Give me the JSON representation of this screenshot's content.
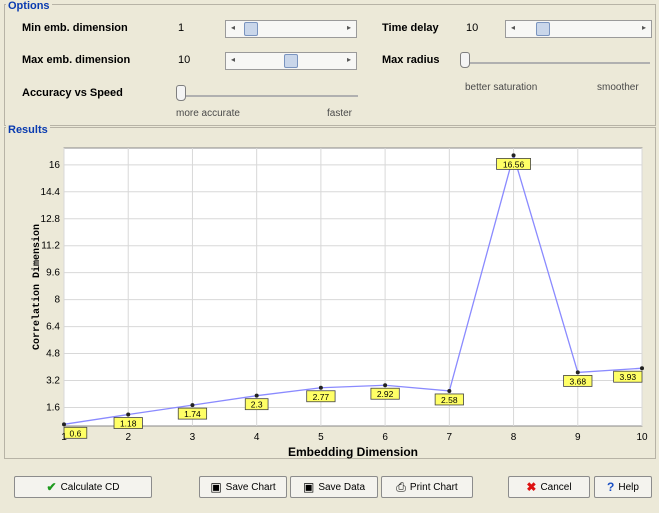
{
  "options": {
    "title": "Options",
    "min_emb": {
      "label": "Min emb. dimension",
      "value": "1"
    },
    "max_emb": {
      "label": "Max emb. dimension",
      "value": "10"
    },
    "time_delay": {
      "label": "Time delay",
      "value": "10"
    },
    "max_radius": {
      "label": "Max radius",
      "left_hint": "better saturation",
      "right_hint": "smoother"
    },
    "accuracy": {
      "label": "Accuracy vs Speed",
      "left_hint": "more accurate",
      "right_hint": "faster"
    }
  },
  "results": {
    "title": "Results"
  },
  "chart_data": {
    "type": "line",
    "xlabel": "Embedding Dimension",
    "ylabel": "Correlation Dimension",
    "x": [
      1,
      2,
      3,
      4,
      5,
      6,
      7,
      8,
      9,
      10
    ],
    "values": [
      0.6,
      1.18,
      1.74,
      2.3,
      2.77,
      2.92,
      2.58,
      16.56,
      3.68,
      3.93
    ],
    "data_labels": [
      "0.6",
      "1.18",
      "1.74",
      "2.3",
      "2.77",
      "2.92",
      "2.58",
      "16.56",
      "3.68",
      "3.93"
    ],
    "xlim": [
      1,
      10
    ],
    "ylim": [
      0.5,
      17
    ],
    "x_ticks": [
      "1",
      "2",
      "3",
      "4",
      "5",
      "6",
      "7",
      "8",
      "9",
      "10"
    ],
    "y_ticks": [
      "1.6",
      "3.2",
      "4.8",
      "6.4",
      "8",
      "9.6",
      "11.2",
      "12.8",
      "14.4",
      "16"
    ],
    "y_tick_values": [
      1.6,
      3.2,
      4.8,
      6.4,
      8,
      9.6,
      11.2,
      12.8,
      14.4,
      16
    ],
    "grid": true,
    "line_color": "#8a8aff",
    "label_bg": "#ffff66"
  },
  "buttons": {
    "calculate": "Calculate CD",
    "save_chart": "Save Chart",
    "save_data": "Save Data",
    "print_chart": "Print Chart",
    "cancel": "Cancel",
    "help": "Help"
  },
  "icons": {
    "check": "check-icon",
    "disk": "floppy-disk-icon",
    "printer": "printer-icon",
    "cancel": "cross-icon",
    "help": "question-icon"
  }
}
